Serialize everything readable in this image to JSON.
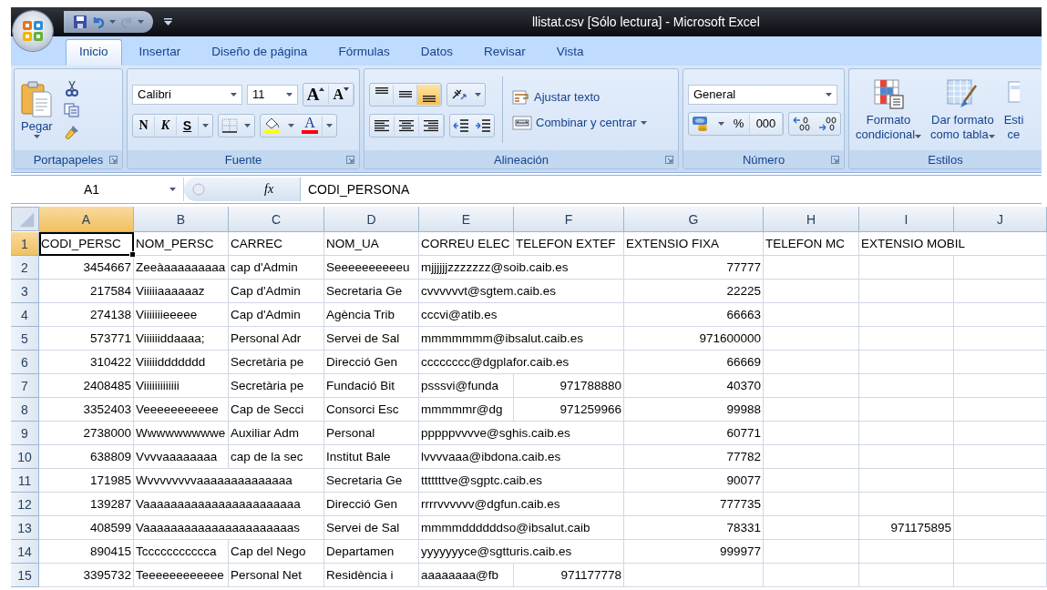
{
  "window": {
    "title": "llistat.csv [Sólo lectura] - Microsoft Excel"
  },
  "quick_access": {
    "redo_disabled": true
  },
  "tabs": [
    {
      "label": "Inicio",
      "selected": true
    },
    {
      "label": "Insertar",
      "selected": false
    },
    {
      "label": "Diseño de página",
      "selected": false
    },
    {
      "label": "Fórmulas",
      "selected": false
    },
    {
      "label": "Datos",
      "selected": false
    },
    {
      "label": "Revisar",
      "selected": false
    },
    {
      "label": "Vista",
      "selected": false
    }
  ],
  "clipboard": {
    "title": "Portapapeles",
    "paste": "Pegar"
  },
  "font": {
    "title": "Fuente",
    "family": "Calibri",
    "size": "11",
    "grow": "A",
    "shrink": "A",
    "bold": "N",
    "italic": "K",
    "underline": "S",
    "font_color": "A"
  },
  "alignment": {
    "title": "Alineación",
    "vertical": [
      {
        "kind": "top",
        "selected": false
      },
      {
        "kind": "middle",
        "selected": false
      },
      {
        "kind": "bottom",
        "selected": true
      }
    ],
    "horizontal": [
      {
        "kind": "left",
        "selected": false
      },
      {
        "kind": "center",
        "selected": false
      },
      {
        "kind": "right",
        "selected": false
      }
    ],
    "wrap": "Ajustar texto",
    "merge": "Combinar y centrar"
  },
  "number": {
    "title": "Número",
    "format": "General",
    "percent": "%",
    "thousands": "000"
  },
  "styles": {
    "title": "Estilos",
    "buttons": [
      {
        "kind": "conditional",
        "lines": [
          "Formato",
          "condicional"
        ]
      },
      {
        "kind": "table",
        "lines": [
          "Dar formato",
          "como tabla"
        ]
      },
      {
        "kind": "cell",
        "lines": [
          "Esti",
          "ce"
        ]
      }
    ]
  },
  "formula_bar": {
    "name_box": "A1",
    "function_label": "fx",
    "value": "CODI_PERSONA"
  },
  "sheet": {
    "columns": [
      {
        "letter": "A",
        "selected": true
      },
      {
        "letter": "B",
        "selected": false
      },
      {
        "letter": "C",
        "selected": false
      },
      {
        "letter": "D",
        "selected": false
      },
      {
        "letter": "E",
        "selected": false
      },
      {
        "letter": "F",
        "selected": false
      },
      {
        "letter": "G",
        "selected": false
      },
      {
        "letter": "H",
        "selected": false
      },
      {
        "letter": "I",
        "selected": false
      },
      {
        "letter": "J",
        "selected": false
      }
    ],
    "rows": [
      {
        "number": "1",
        "selected": true,
        "cells": [
          {
            "text": "CODI_PERSC",
            "kind": "text",
            "selected": true
          },
          {
            "text": "NOM_PERSC",
            "kind": "text",
            "selected": false
          },
          {
            "text": "CARREC",
            "kind": "text",
            "selected": false
          },
          {
            "text": "NOM_UA",
            "kind": "text",
            "selected": false
          },
          {
            "text": "CORREU ELEC",
            "kind": "text",
            "selected": false
          },
          {
            "text": "TELEFON EXTEF",
            "kind": "text",
            "selected": false
          },
          {
            "text": "EXTENSIO FIXA",
            "kind": "text",
            "selected": false
          },
          {
            "text": "TELEFON MC",
            "kind": "text",
            "selected": false
          },
          {
            "text": "EXTENSIO MOBIL",
            "kind": "text",
            "selected": false
          },
          null
        ]
      },
      {
        "number": "2",
        "selected": false,
        "cells": [
          {
            "text": "3454667",
            "kind": "number",
            "selected": false
          },
          {
            "text": "Zeeàaaaaaaaaa",
            "kind": "text",
            "selected": false
          },
          {
            "text": "cap d'Admin",
            "kind": "text",
            "selected": false
          },
          {
            "text": "Seeeeeeeeeeu",
            "kind": "text",
            "selected": false
          },
          {
            "text": "mjjjjjjzzzzzzz@soib.caib.es",
            "kind": "text",
            "selected": false
          },
          null,
          {
            "text": "77777",
            "kind": "number",
            "selected": false
          },
          null,
          null,
          null
        ]
      },
      {
        "number": "3",
        "selected": false,
        "cells": [
          {
            "text": "217584",
            "kind": "number",
            "selected": false
          },
          {
            "text": "Viiiiiaaaaaaz",
            "kind": "text",
            "selected": false
          },
          {
            "text": "Cap d'Admin",
            "kind": "text",
            "selected": false
          },
          {
            "text": "Secretaria Ge",
            "kind": "text",
            "selected": false
          },
          {
            "text": "cvvvvvvt@sgtem.caib.es",
            "kind": "text",
            "selected": false
          },
          null,
          {
            "text": "22225",
            "kind": "number",
            "selected": false
          },
          null,
          null,
          null
        ]
      },
      {
        "number": "4",
        "selected": false,
        "cells": [
          {
            "text": "274138",
            "kind": "number",
            "selected": false
          },
          {
            "text": "Viiiiiiieeeee",
            "kind": "text",
            "selected": false
          },
          {
            "text": "Cap d'Admin",
            "kind": "text",
            "selected": false
          },
          {
            "text": "Agència Trib",
            "kind": "text",
            "selected": false
          },
          {
            "text": "cccvi@atib.es",
            "kind": "text",
            "selected": false
          },
          null,
          {
            "text": "66663",
            "kind": "number",
            "selected": false
          },
          null,
          null,
          null
        ]
      },
      {
        "number": "5",
        "selected": false,
        "cells": [
          {
            "text": "573771",
            "kind": "number",
            "selected": false
          },
          {
            "text": "Viiiiiiddaaaa;",
            "kind": "text",
            "selected": false
          },
          {
            "text": "Personal Adr",
            "kind": "text",
            "selected": false
          },
          {
            "text": "Servei de Sal",
            "kind": "text",
            "selected": false
          },
          {
            "text": "mmmmmmm@ibsalut.caib.es",
            "kind": "text",
            "selected": false
          },
          null,
          {
            "text": "971600000",
            "kind": "number",
            "selected": false
          },
          null,
          null,
          null
        ]
      },
      {
        "number": "6",
        "selected": false,
        "cells": [
          {
            "text": "310422",
            "kind": "number",
            "selected": false
          },
          {
            "text": "Viiiiiddddddd",
            "kind": "text",
            "selected": false
          },
          {
            "text": "Secretària pe",
            "kind": "text",
            "selected": false
          },
          {
            "text": "Direcció Gen",
            "kind": "text",
            "selected": false
          },
          {
            "text": "cccccccc@dgplafor.caib.es",
            "kind": "text",
            "selected": false
          },
          null,
          {
            "text": "66669",
            "kind": "number",
            "selected": false
          },
          null,
          null,
          null
        ]
      },
      {
        "number": "7",
        "selected": false,
        "cells": [
          {
            "text": "2408485",
            "kind": "number",
            "selected": false
          },
          {
            "text": "Viiiiiiiiiiiii",
            "kind": "text",
            "selected": false
          },
          {
            "text": "Secretària pe",
            "kind": "text",
            "selected": false
          },
          {
            "text": "Fundació Bit",
            "kind": "text",
            "selected": false
          },
          {
            "text": "psssvi@funda",
            "kind": "text",
            "selected": false
          },
          {
            "text": "971788880",
            "kind": "number",
            "selected": false
          },
          {
            "text": "40370",
            "kind": "number",
            "selected": false
          },
          null,
          null,
          null
        ]
      },
      {
        "number": "8",
        "selected": false,
        "cells": [
          {
            "text": "3352403",
            "kind": "number",
            "selected": false
          },
          {
            "text": "Veeeeeeeeeee",
            "kind": "text",
            "selected": false
          },
          {
            "text": "Cap de Secci",
            "kind": "text",
            "selected": false
          },
          {
            "text": "Consorci Esc",
            "kind": "text",
            "selected": false
          },
          {
            "text": "mmmmmr@dg",
            "kind": "text",
            "selected": false
          },
          {
            "text": "971259966",
            "kind": "number",
            "selected": false
          },
          {
            "text": "99988",
            "kind": "number",
            "selected": false
          },
          null,
          null,
          null
        ]
      },
      {
        "number": "9",
        "selected": false,
        "cells": [
          {
            "text": "2738000",
            "kind": "number",
            "selected": false
          },
          {
            "text": "Wwwwwwwwwe",
            "kind": "text",
            "selected": false
          },
          {
            "text": "Auxiliar Adm",
            "kind": "text",
            "selected": false
          },
          {
            "text": "Personal",
            "kind": "text",
            "selected": false
          },
          {
            "text": "pppppvvvve@sghis.caib.es",
            "kind": "text",
            "selected": false
          },
          null,
          {
            "text": "60771",
            "kind": "number",
            "selected": false
          },
          null,
          null,
          null
        ]
      },
      {
        "number": "10",
        "selected": false,
        "cells": [
          {
            "text": "638809",
            "kind": "number",
            "selected": false
          },
          {
            "text": "Vvvvaaaaaaaa",
            "kind": "text",
            "selected": false
          },
          {
            "text": "cap de la sec",
            "kind": "text",
            "selected": false
          },
          {
            "text": "Institut Bale",
            "kind": "text",
            "selected": false
          },
          {
            "text": "lvvvvaaa@ibdona.caib.es",
            "kind": "text",
            "selected": false
          },
          null,
          {
            "text": "77782",
            "kind": "number",
            "selected": false
          },
          null,
          null,
          null
        ]
      },
      {
        "number": "11",
        "selected": false,
        "cells": [
          {
            "text": "171985",
            "kind": "number",
            "selected": false
          },
          {
            "text": "Wvvvvvvvvaaaaaaaaaaaaaa",
            "kind": "text",
            "selected": false
          },
          null,
          {
            "text": "Secretaria Ge",
            "kind": "text",
            "selected": false
          },
          {
            "text": "tttttttve@sgptc.caib.es",
            "kind": "text",
            "selected": false
          },
          null,
          {
            "text": "90077",
            "kind": "number",
            "selected": false
          },
          null,
          null,
          null
        ]
      },
      {
        "number": "12",
        "selected": false,
        "cells": [
          {
            "text": "139287",
            "kind": "number",
            "selected": false
          },
          {
            "text": "Vaaaaaaaaaaaaaaaaaaaaaaa",
            "kind": "text",
            "selected": false
          },
          null,
          {
            "text": "Direcció Gen",
            "kind": "text",
            "selected": false
          },
          {
            "text": "rrrrvvvvvv@dgfun.caib.es",
            "kind": "text",
            "selected": false
          },
          null,
          {
            "text": "777735",
            "kind": "number",
            "selected": false
          },
          null,
          null,
          null
        ]
      },
      {
        "number": "13",
        "selected": false,
        "cells": [
          {
            "text": "408599",
            "kind": "number",
            "selected": false
          },
          {
            "text": "Vaaaaaaaaaaaaaaaaaaaaaas",
            "kind": "text",
            "selected": false
          },
          null,
          {
            "text": "Servei de Sal",
            "kind": "text",
            "selected": false
          },
          {
            "text": "mmmmddddddso@ibsalut.caib",
            "kind": "text",
            "selected": false
          },
          null,
          {
            "text": "78331",
            "kind": "number",
            "selected": false
          },
          null,
          {
            "text": "971175895",
            "kind": "number",
            "selected": false
          },
          null
        ]
      },
      {
        "number": "14",
        "selected": false,
        "cells": [
          {
            "text": "890415",
            "kind": "number",
            "selected": false
          },
          {
            "text": "Tccccccccccca",
            "kind": "text",
            "selected": false
          },
          {
            "text": "Cap del Nego",
            "kind": "text",
            "selected": false
          },
          {
            "text": "Departamen",
            "kind": "text",
            "selected": false
          },
          {
            "text": "yyyyyyyce@sgtturis.caib.es",
            "kind": "text",
            "selected": false
          },
          null,
          {
            "text": "999977",
            "kind": "number",
            "selected": false
          },
          null,
          null,
          null
        ]
      },
      {
        "number": "15",
        "selected": false,
        "cells": [
          {
            "text": "3395732",
            "kind": "number",
            "selected": false
          },
          {
            "text": "Teeeeeeeeeeee",
            "kind": "text",
            "selected": false
          },
          {
            "text": "Personal Net",
            "kind": "text",
            "selected": false
          },
          {
            "text": "Residència i",
            "kind": "text",
            "selected": false
          },
          {
            "text": "aaaaaaaa@fb",
            "kind": "text",
            "selected": false
          },
          {
            "text": "971177778",
            "kind": "number",
            "selected": false
          },
          null,
          null,
          null,
          null
        ]
      }
    ]
  }
}
